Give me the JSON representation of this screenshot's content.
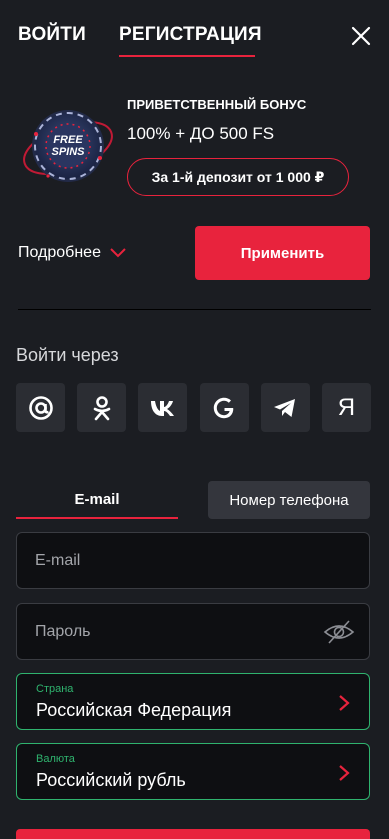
{
  "header": {
    "login_tab": "ВОЙТИ",
    "register_tab": "РЕГИСТРАЦИЯ",
    "active_tab": "register"
  },
  "bonus": {
    "title": "ПРИВЕТСТВЕННЫЙ БОНУС",
    "amount": "100% + ДО 500 FS",
    "deposit_label": "За 1-й депозит от 1 000 ₽",
    "image_text_top": "FREE",
    "image_text_bottom": "SPINS"
  },
  "actions": {
    "more_label": "Подробнее",
    "apply_label": "Применить"
  },
  "social": {
    "title": "Войти через",
    "providers": [
      {
        "name": "mail",
        "glyph": "@"
      },
      {
        "name": "odnoklassniki",
        "glyph": ""
      },
      {
        "name": "vk",
        "glyph": "vk"
      },
      {
        "name": "google",
        "glyph": "G"
      },
      {
        "name": "telegram",
        "glyph": ""
      },
      {
        "name": "yandex",
        "glyph": "Я"
      }
    ]
  },
  "mode": {
    "email_label": "E-mail",
    "phone_label": "Номер телефона",
    "active": "email"
  },
  "form": {
    "email_placeholder": "E-mail",
    "email_value": "",
    "password_placeholder": "Пароль",
    "password_value": "",
    "country_label": "Страна",
    "country_value": "Российская Федерация",
    "currency_label": "Валюта",
    "currency_value": "Российский рубль"
  },
  "colors": {
    "background": "#1b1d22",
    "accent": "#e8233d",
    "success": "#2fb36e",
    "tile": "#2b2d33",
    "input_bg": "#0e0f12"
  }
}
